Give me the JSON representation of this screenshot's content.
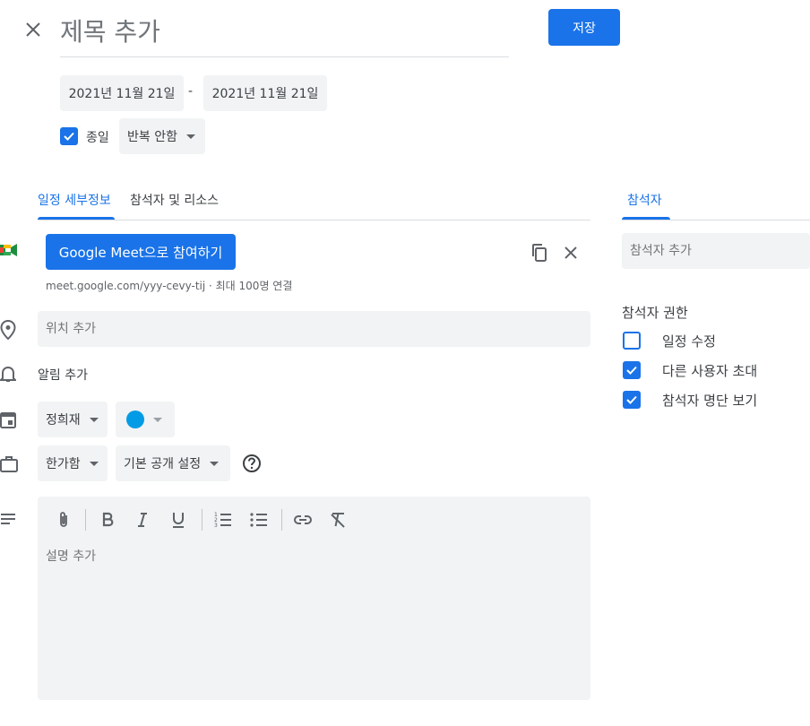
{
  "header": {
    "title_placeholder": "제목 추가",
    "save_label": "저장"
  },
  "dates": {
    "start": "2021년 11월 21일",
    "separator": "-",
    "end": "2021년 11월 21일"
  },
  "all_day": {
    "label": "종일",
    "checked": true
  },
  "repeat": {
    "selected": "반복 안함"
  },
  "tabs": [
    {
      "label": "일정 세부정보",
      "active": true
    },
    {
      "label": "참석자 및 리소스",
      "active": false
    }
  ],
  "meet": {
    "join_label": "Google Meet으로 참여하기",
    "link_info": "meet.google.com/yyy-cevy-tij · 최대 100명 연결"
  },
  "location": {
    "placeholder": "위치 추가"
  },
  "notification": {
    "label": "알림 추가"
  },
  "calendar": {
    "owner": "정희재",
    "color": "#039be5"
  },
  "visibility": {
    "busy": "한가함",
    "privacy": "기본 공개 설정"
  },
  "description": {
    "placeholder": "설명 추가"
  },
  "guests_panel": {
    "tab_label": "참석자",
    "add_placeholder": "참석자 추가",
    "permissions_title": "참석자 권한",
    "permissions": [
      {
        "label": "일정 수정",
        "checked": false
      },
      {
        "label": "다른 사용자 초대",
        "checked": true
      },
      {
        "label": "참석자 명단 보기",
        "checked": true
      }
    ]
  },
  "colors": {
    "accent": "#1a73e8",
    "field_bg": "#f1f3f4"
  }
}
